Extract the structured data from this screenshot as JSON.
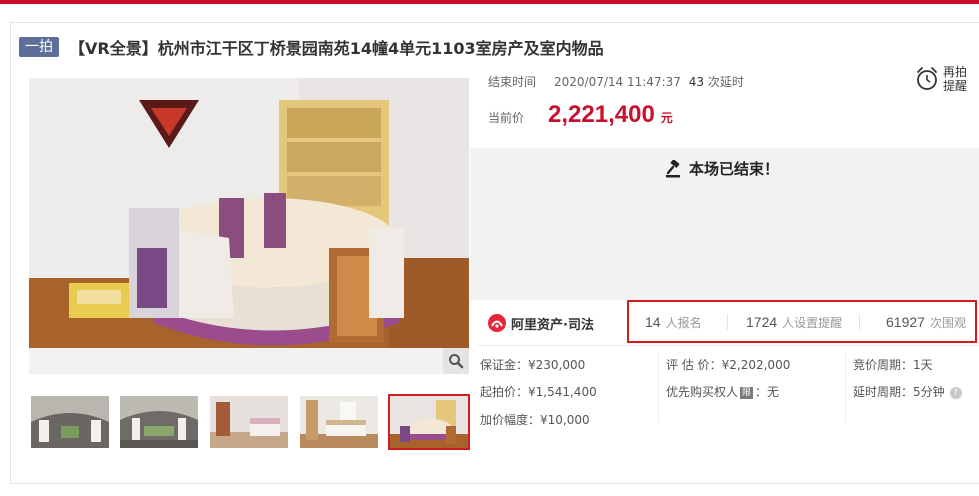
{
  "title": {
    "tag": "一拍",
    "text": "【VR全景】杭州市江干区丁桥景园南苑14幢4单元1103室房产及室内物品"
  },
  "auction": {
    "end_label": "结束时间",
    "end_time": "2020/07/14 11:47:37",
    "delay_count": "43",
    "delay_label": "次延时",
    "price_label": "当前价",
    "price": "2,221,400",
    "price_unit": "元",
    "remind_line1": "再拍",
    "remind_line2": "提醒",
    "status_text": "本场已结束！"
  },
  "brand": {
    "name": "阿里资产·司法"
  },
  "stats": [
    {
      "num": "14",
      "unit": "人报名"
    },
    {
      "num": "1724",
      "unit": "人设置提醒"
    },
    {
      "num": "61927",
      "unit": "次围观"
    }
  ],
  "details": {
    "deposit": "保证金：¥230,000",
    "appraisal": "评 估 价：¥2,202,000",
    "period": "竞价周期：1天",
    "start_price": "起拍价：¥1,541,400",
    "priority_pre": "优先购买权人",
    "priority_badge": "限",
    "priority_post": "：无",
    "delay": "延时周期：5分钟",
    "increment": "加价幅度：¥10,000"
  },
  "icons": {
    "zoom": "magnifier-icon",
    "alarm": "alarm-clock-icon",
    "gavel": "gavel-icon",
    "help": "question-icon"
  },
  "colors": {
    "accent": "#c8102e",
    "tag": "#5d6f99",
    "selected_border": "#d11d1d"
  }
}
